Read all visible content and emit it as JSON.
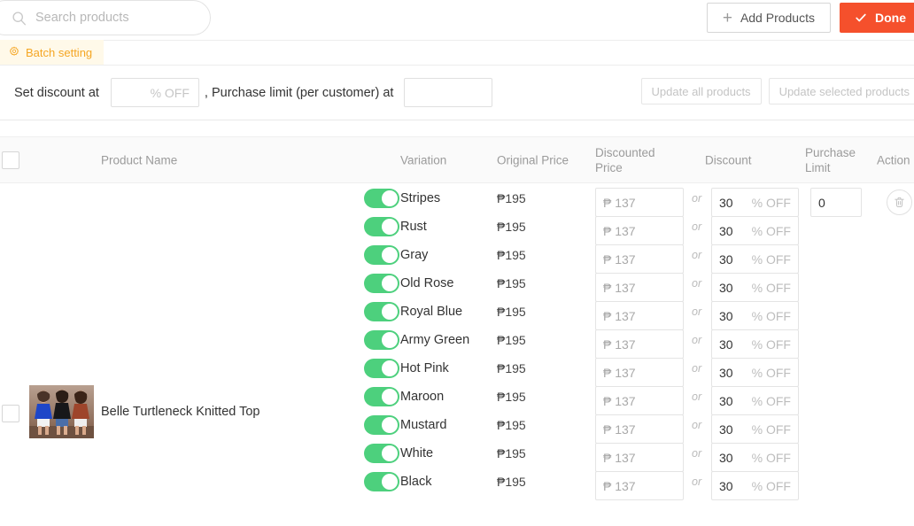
{
  "topbar": {
    "search": {
      "placeholder": "Search products",
      "value": "",
      "icon": "search-icon"
    },
    "add_products_label": "Add Products",
    "add_products_icon": "plus-icon",
    "done_label": "Done",
    "done_icon": "check-icon",
    "done_color": "#f5502c"
  },
  "batch_tab": {
    "label": "Batch setting",
    "icon": "gear-icon",
    "text_color": "#f5a623",
    "background": "#fff9e9"
  },
  "batch_panel": {
    "set_discount_label": "Set discount at",
    "discount_placeholder": "% OFF",
    "discount_value": "",
    "purchase_limit_label": ", Purchase limit (per customer) at",
    "purchase_limit_placeholder": "",
    "purchase_limit_value": "",
    "update_all_label": "Update all products",
    "update_selected_label": "Update selected products"
  },
  "table": {
    "headers": {
      "product_name": "Product Name",
      "variation": "Variation",
      "original_price": "Original Price",
      "discounted_price": "Discounted Price",
      "discount": "Discount",
      "purchase_limit": "Purchase Limit",
      "action": "Action"
    },
    "select_all_checked": false,
    "product": {
      "name": "Belle Turtleneck Knitted Top",
      "checked": false,
      "thumbnail": "three-women-in-knitted-tops-photo"
    },
    "toggle_on_color": "#4dd07d",
    "or_text": "or",
    "percent_suffix": "% OFF",
    "delete_icon": "trash-icon",
    "variations": [
      {
        "name": "Stripes",
        "enabled": true,
        "original_price": "₱195",
        "discounted_price": "₱ 137",
        "discount": "30",
        "purchase_limit": "0",
        "show_limit": true,
        "show_action": true
      },
      {
        "name": "Rust",
        "enabled": true,
        "original_price": "₱195",
        "discounted_price": "₱ 137",
        "discount": "30",
        "purchase_limit": "",
        "show_limit": false,
        "show_action": false
      },
      {
        "name": "Gray",
        "enabled": true,
        "original_price": "₱195",
        "discounted_price": "₱ 137",
        "discount": "30",
        "purchase_limit": "",
        "show_limit": false,
        "show_action": false
      },
      {
        "name": "Old Rose",
        "enabled": true,
        "original_price": "₱195",
        "discounted_price": "₱ 137",
        "discount": "30",
        "purchase_limit": "",
        "show_limit": false,
        "show_action": false
      },
      {
        "name": "Royal Blue",
        "enabled": true,
        "original_price": "₱195",
        "discounted_price": "₱ 137",
        "discount": "30",
        "purchase_limit": "",
        "show_limit": false,
        "show_action": false
      },
      {
        "name": "Army Green",
        "enabled": true,
        "original_price": "₱195",
        "discounted_price": "₱ 137",
        "discount": "30",
        "purchase_limit": "",
        "show_limit": false,
        "show_action": false
      },
      {
        "name": "Hot Pink",
        "enabled": true,
        "original_price": "₱195",
        "discounted_price": "₱ 137",
        "discount": "30",
        "purchase_limit": "",
        "show_limit": false,
        "show_action": false
      },
      {
        "name": "Maroon",
        "enabled": true,
        "original_price": "₱195",
        "discounted_price": "₱ 137",
        "discount": "30",
        "purchase_limit": "",
        "show_limit": false,
        "show_action": false
      },
      {
        "name": "Mustard",
        "enabled": true,
        "original_price": "₱195",
        "discounted_price": "₱ 137",
        "discount": "30",
        "purchase_limit": "",
        "show_limit": false,
        "show_action": false
      },
      {
        "name": "White",
        "enabled": true,
        "original_price": "₱195",
        "discounted_price": "₱ 137",
        "discount": "30",
        "purchase_limit": "",
        "show_limit": false,
        "show_action": false
      },
      {
        "name": "Black",
        "enabled": true,
        "original_price": "₱195",
        "discounted_price": "₱ 137",
        "discount": "30",
        "purchase_limit": "",
        "show_limit": false,
        "show_action": false
      }
    ]
  }
}
